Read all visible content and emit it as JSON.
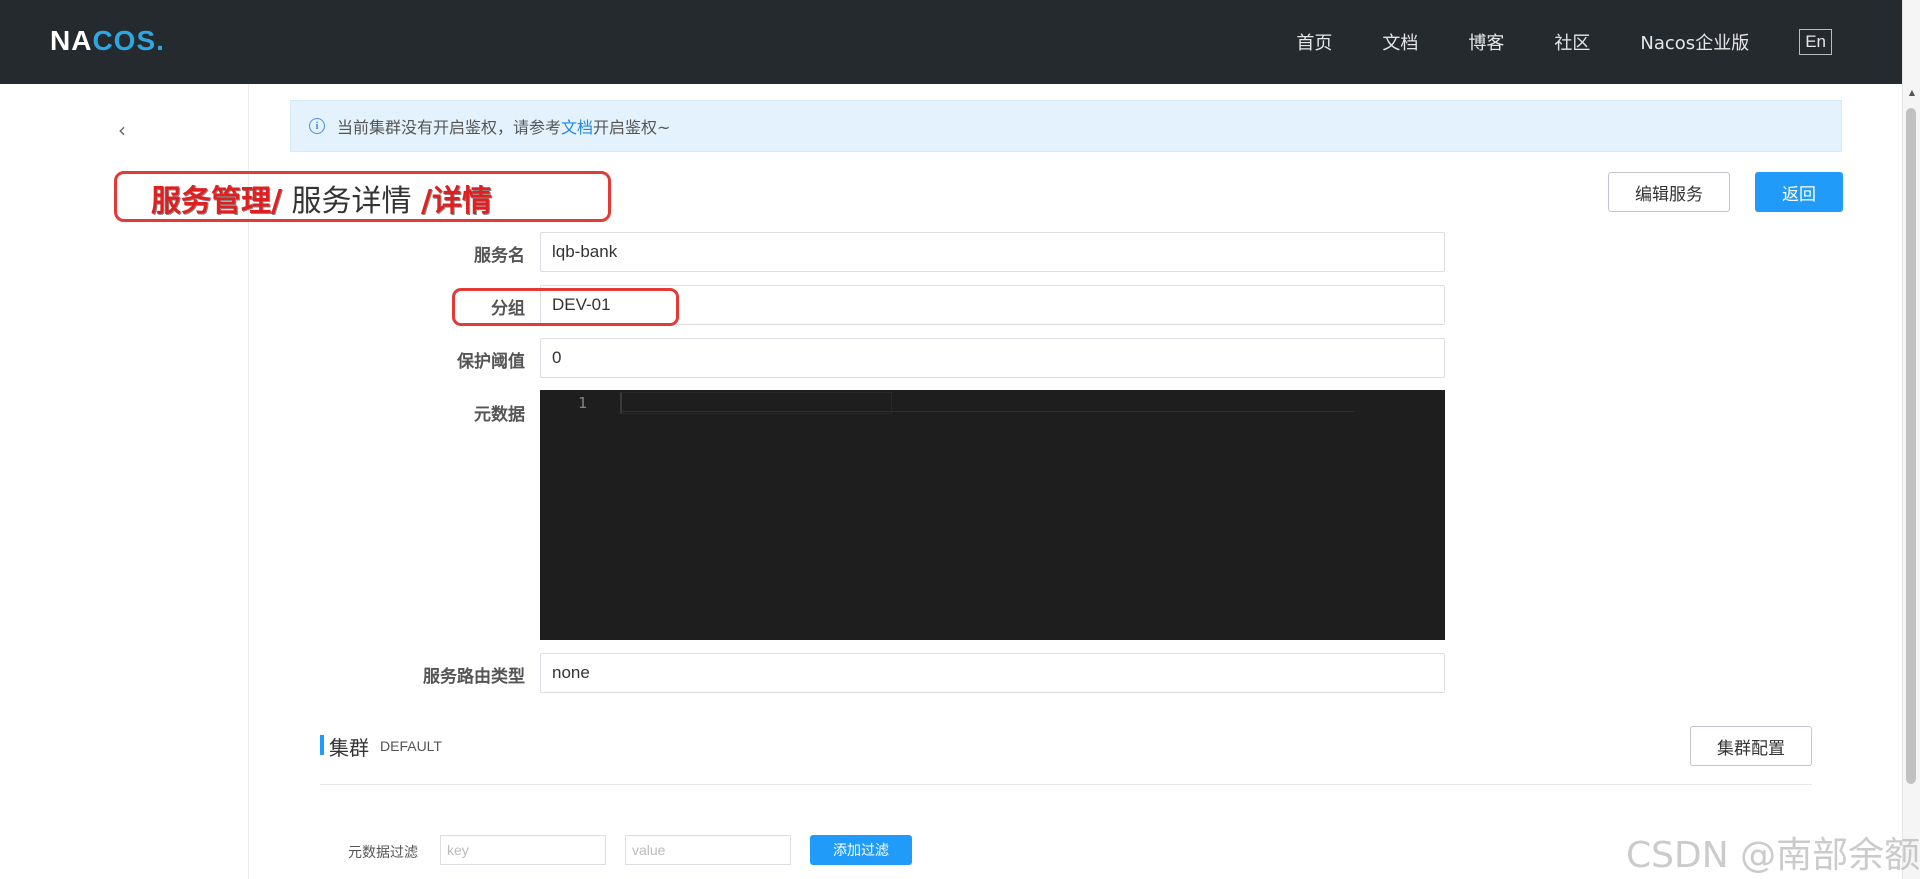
{
  "header": {
    "logo_text_a": "NA",
    "logo_text_b": "COS",
    "logo_text_c": ".",
    "nav": [
      "首页",
      "文档",
      "博客",
      "社区",
      "Nacos企业版"
    ],
    "lang": "En"
  },
  "alert": {
    "text_before": "当前集群没有开启鉴权，请参考",
    "link": "文档",
    "text_after": "开启鉴权~"
  },
  "breadcrumb": {
    "part1": "服务管理/",
    "part2": " 服务详情 ",
    "part3": "/详情"
  },
  "actions": {
    "edit": "编辑服务",
    "back": "返回"
  },
  "form": {
    "service_name_label": "服务名",
    "service_name": "lqb-bank",
    "group_label": "分组",
    "group": "DEV-01",
    "threshold_label": "保护阈值",
    "threshold": "0",
    "metadata_label": "元数据",
    "metadata_line": "1",
    "selector_label": "服务路由类型",
    "selector": "none"
  },
  "cluster": {
    "title": "集群",
    "name": "DEFAULT",
    "config_button": "集群配置"
  },
  "filter": {
    "label": "元数据过滤",
    "key_placeholder": "key",
    "value_placeholder": "value",
    "add_button": "添加过滤"
  },
  "watermark": "CSDN @南部余额"
}
